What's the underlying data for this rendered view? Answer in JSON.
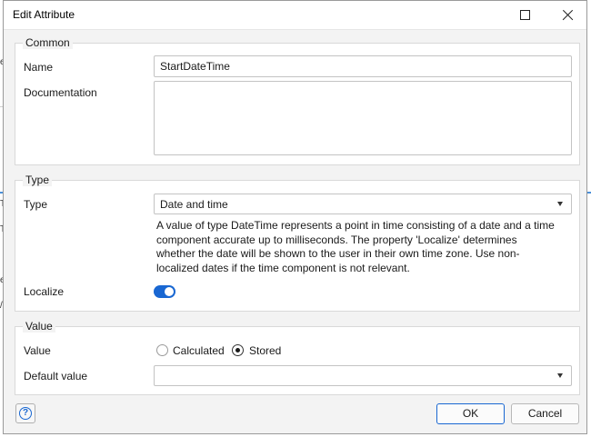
{
  "dialog": {
    "title": "Edit Attribute"
  },
  "background": {
    "fragments": [
      "e",
      "Ti",
      "Ti",
      "e",
      "/T"
    ]
  },
  "common": {
    "legend": "Common",
    "name_label": "Name",
    "name_value": "StartDateTime",
    "documentation_label": "Documentation",
    "documentation_value": ""
  },
  "type": {
    "legend": "Type",
    "type_label": "Type",
    "type_value": "Date and time",
    "description": "A value of type DateTime represents a point in time consisting of a date and a time component accurate up to milliseconds. The property 'Localize' determines whether the date will be shown to the user in their own time zone. Use non-localized dates if the time component is not relevant.",
    "localize_label": "Localize",
    "localize_on": true
  },
  "value": {
    "legend": "Value",
    "value_label": "Value",
    "options": [
      "Calculated",
      "Stored"
    ],
    "selected": "Stored",
    "default_value_label": "Default value",
    "default_value": ""
  },
  "buttons": {
    "help": "?",
    "ok": "OK",
    "cancel": "Cancel"
  },
  "colors": {
    "accent": "#1967d2",
    "dialog_bg": "#f3f3f3",
    "group_border": "#d9d9d9"
  },
  "icons": [
    "maximize-icon",
    "close-icon",
    "dropdown-caret-icon",
    "help-icon"
  ]
}
